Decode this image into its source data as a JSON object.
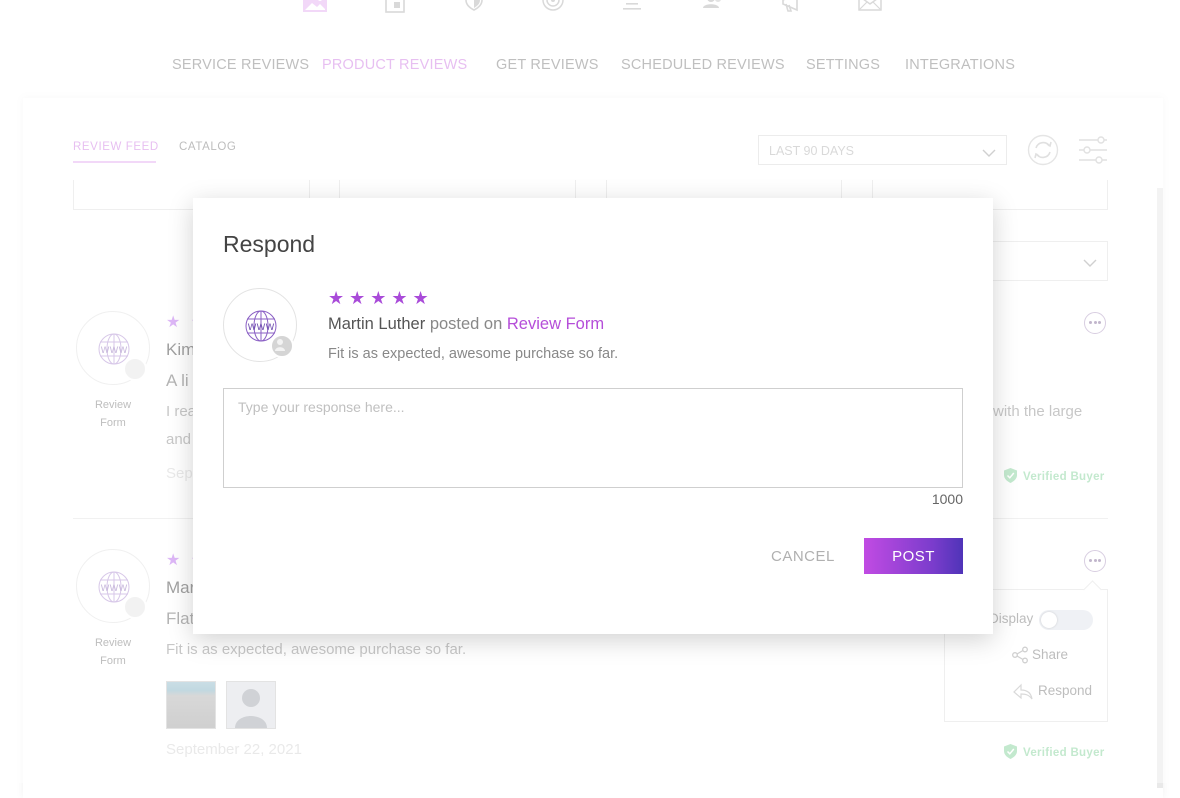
{
  "topnav_icons": [
    "image-icon",
    "tablet-icon",
    "shield-icon",
    "target-icon",
    "align-center-icon",
    "users-icon",
    "megaphone-icon",
    "envelope-icon"
  ],
  "main_nav": [
    {
      "label": "SERVICE REVIEWS",
      "active": false
    },
    {
      "label": "PRODUCT REVIEWS",
      "active": true
    },
    {
      "label": "GET REVIEWS",
      "active": false
    },
    {
      "label": "SCHEDULED REVIEWS",
      "active": false
    },
    {
      "label": "SETTINGS",
      "active": false
    },
    {
      "label": "INTEGRATIONS",
      "active": false
    }
  ],
  "sub_tabs": [
    {
      "label": "REVIEW FEED",
      "active": true
    },
    {
      "label": "CATALOG",
      "active": false
    }
  ],
  "date_range": {
    "selected": "LAST 90 DAYS"
  },
  "reviews": [
    {
      "stars": "★ ★",
      "author": "Kim",
      "title": "A li",
      "body_start": "I rea",
      "body_end": "with the large",
      "body_line2": "and",
      "date": "Sep",
      "source_label_1": "Review",
      "source_label_2": "Form",
      "verified": "Verified Buyer"
    },
    {
      "stars": "★ ★",
      "author": "Mar",
      "title": "Flat",
      "body": "Fit is as expected, awesome purchase so far.",
      "date": "September 22, 2021",
      "source_label_1": "Review",
      "source_label_2": "Form",
      "verified": "Verified Buyer"
    }
  ],
  "actions_popover": {
    "display_label": "Display",
    "display_on": false,
    "share_label": "Share",
    "respond_label": "Respond"
  },
  "modal": {
    "title": "Respond",
    "stars": "★★★★★",
    "rating": 5,
    "reviewer": "Martin Luther",
    "posted_on": "posted on",
    "source": "Review Form",
    "review_text": "Fit is as expected, awesome purchase so far.",
    "response_placeholder": "Type your response here...",
    "char_limit": "1000",
    "cancel_label": "CANCEL",
    "post_label": "POST"
  },
  "colors": {
    "accent": "#b54ed9",
    "nav_active": "#d48ae6",
    "star": "#a94bd9",
    "verified": "#92d7a6"
  }
}
